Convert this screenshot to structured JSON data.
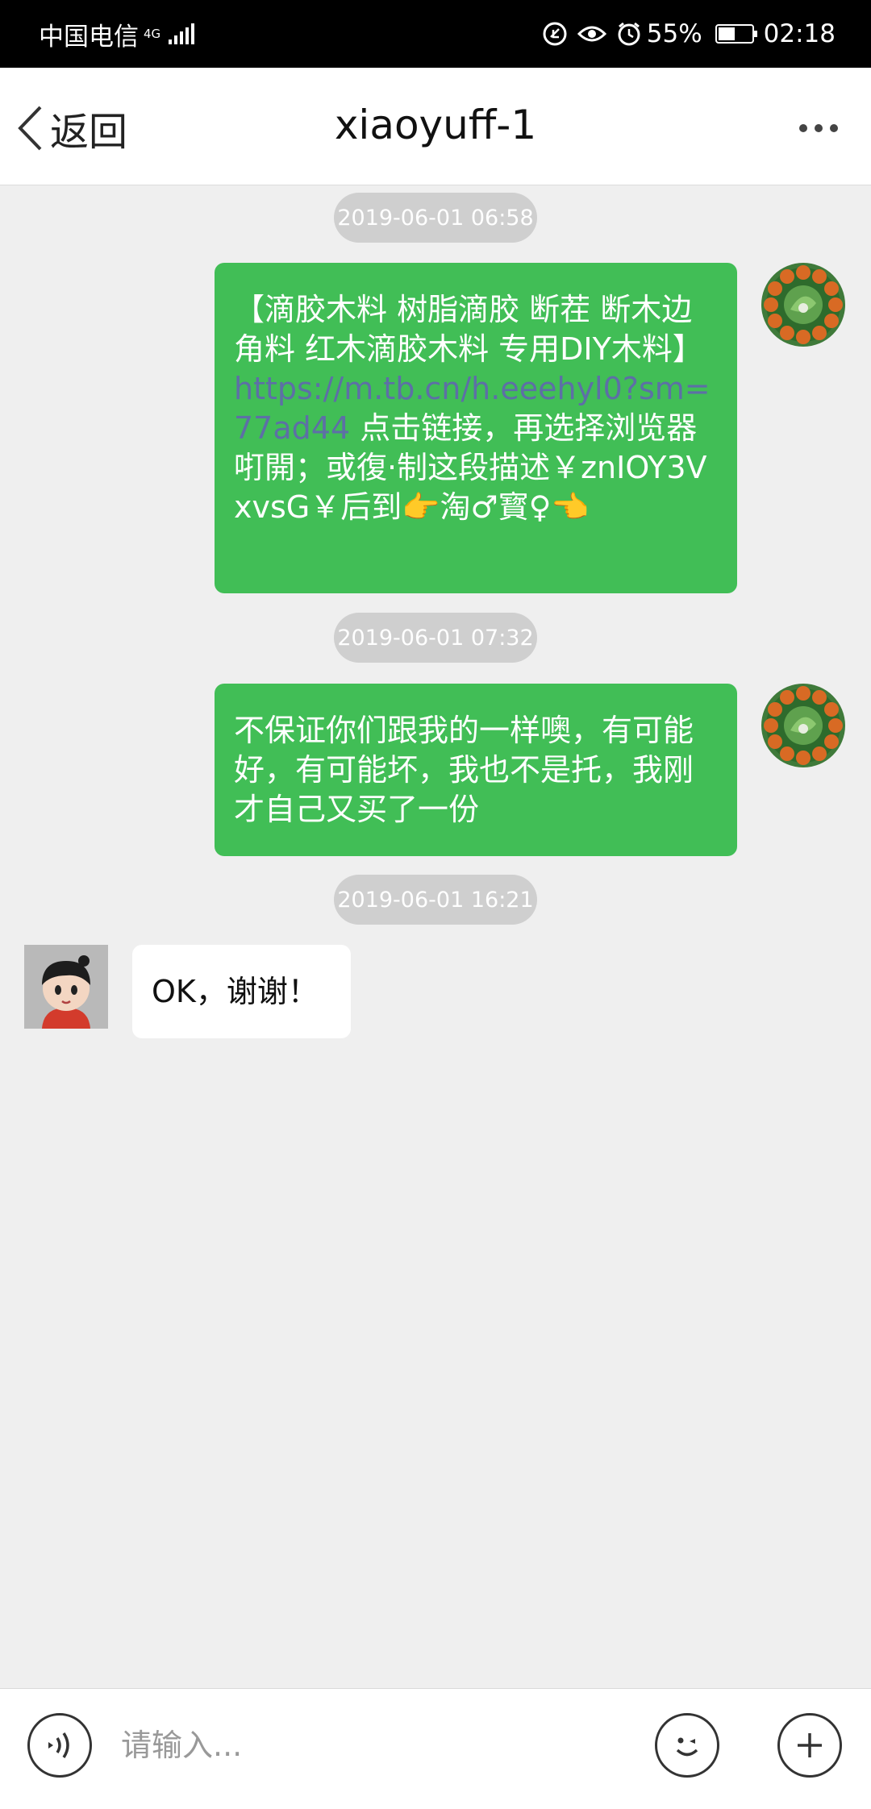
{
  "status_bar": {
    "carrier": "中国电信",
    "network": "4G",
    "battery": "55%",
    "battery_level": 0.55,
    "time": "02:18"
  },
  "header": {
    "back_label": "返回",
    "title": "xiaoyuff-1"
  },
  "messages": [
    {
      "timestamp": "2019-06-01 06:58",
      "direction": "outgoing",
      "text_before": "【滴胶木料 树脂滴胶 断茬 断木边角料 红木滴胶木料 专用DIY木料】",
      "link": "https://m.tb.cn/h.eeehyl0?sm=77ad44",
      "text_after": " 点击链接，再选择浏览器咑開；或復·制这段描述￥znIOY3VxvsG￥后到👉淘♂寳♀👈"
    },
    {
      "timestamp": "2019-06-01 07:32",
      "direction": "outgoing",
      "text": "不保证你们跟我的一样噢，有可能好，有可能坏，我也不是托，我刚才自己又买了一份"
    },
    {
      "timestamp": "2019-06-01 16:21",
      "direction": "incoming",
      "text": "OK，谢谢！"
    }
  ],
  "input": {
    "placeholder": "请输入..."
  },
  "colors": {
    "outgoing_bubble": "#41be56",
    "link": "#5d6fa6",
    "background": "#efefef"
  }
}
